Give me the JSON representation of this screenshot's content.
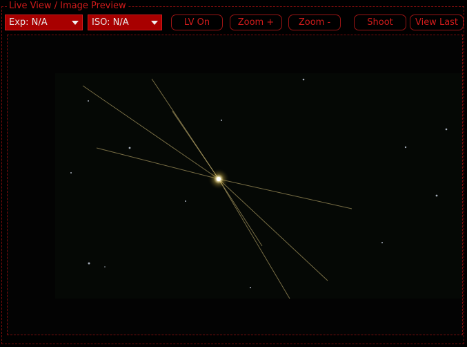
{
  "panel": {
    "title": "Live View / Image Preview"
  },
  "toolbar": {
    "exposure": {
      "label": "Exp: N/A",
      "icon": "chevron-down-icon"
    },
    "iso": {
      "label": "ISO: N/A",
      "icon": "chevron-down-icon"
    },
    "lv_on_label": "LV On",
    "zoom_in_label": "Zoom +",
    "zoom_out_label": "Zoom -",
    "shoot_label": "Shoot",
    "view_last_label": "View Last"
  },
  "theme": {
    "accent": "#d21b1b",
    "dropdown_bg": "#a80000",
    "background": "#000000"
  }
}
